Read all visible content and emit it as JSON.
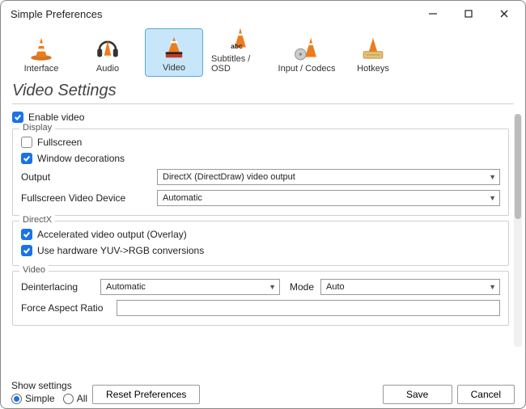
{
  "window": {
    "title": "Simple Preferences"
  },
  "tabs": {
    "interface": "Interface",
    "audio": "Audio",
    "video": "Video",
    "subtitles": "Subtitles / OSD",
    "input": "Input / Codecs",
    "hotkeys": "Hotkeys"
  },
  "heading": "Video Settings",
  "enable_video": {
    "label": "Enable video",
    "checked": true
  },
  "display": {
    "legend": "Display",
    "fullscreen": {
      "label": "Fullscreen",
      "checked": false
    },
    "window_decorations": {
      "label": "Window decorations",
      "checked": true
    },
    "output": {
      "label": "Output",
      "value": "DirectX (DirectDraw) video output"
    },
    "fullscreen_device": {
      "label": "Fullscreen Video Device",
      "value": "Automatic"
    }
  },
  "directx": {
    "legend": "DirectX",
    "accelerated": {
      "label": "Accelerated video output (Overlay)",
      "checked": true
    },
    "yuv_rgb": {
      "label": "Use hardware YUV->RGB conversions",
      "checked": true
    }
  },
  "video": {
    "legend": "Video",
    "deinterlacing": {
      "label": "Deinterlacing",
      "value": "Automatic"
    },
    "mode": {
      "label": "Mode",
      "value": "Auto"
    },
    "force_aspect": {
      "label": "Force Aspect Ratio",
      "value": ""
    }
  },
  "show_settings": {
    "label": "Show settings",
    "simple": "Simple",
    "all": "All",
    "selected": "simple"
  },
  "buttons": {
    "reset": "Reset Preferences",
    "save": "Save",
    "cancel": "Cancel"
  }
}
